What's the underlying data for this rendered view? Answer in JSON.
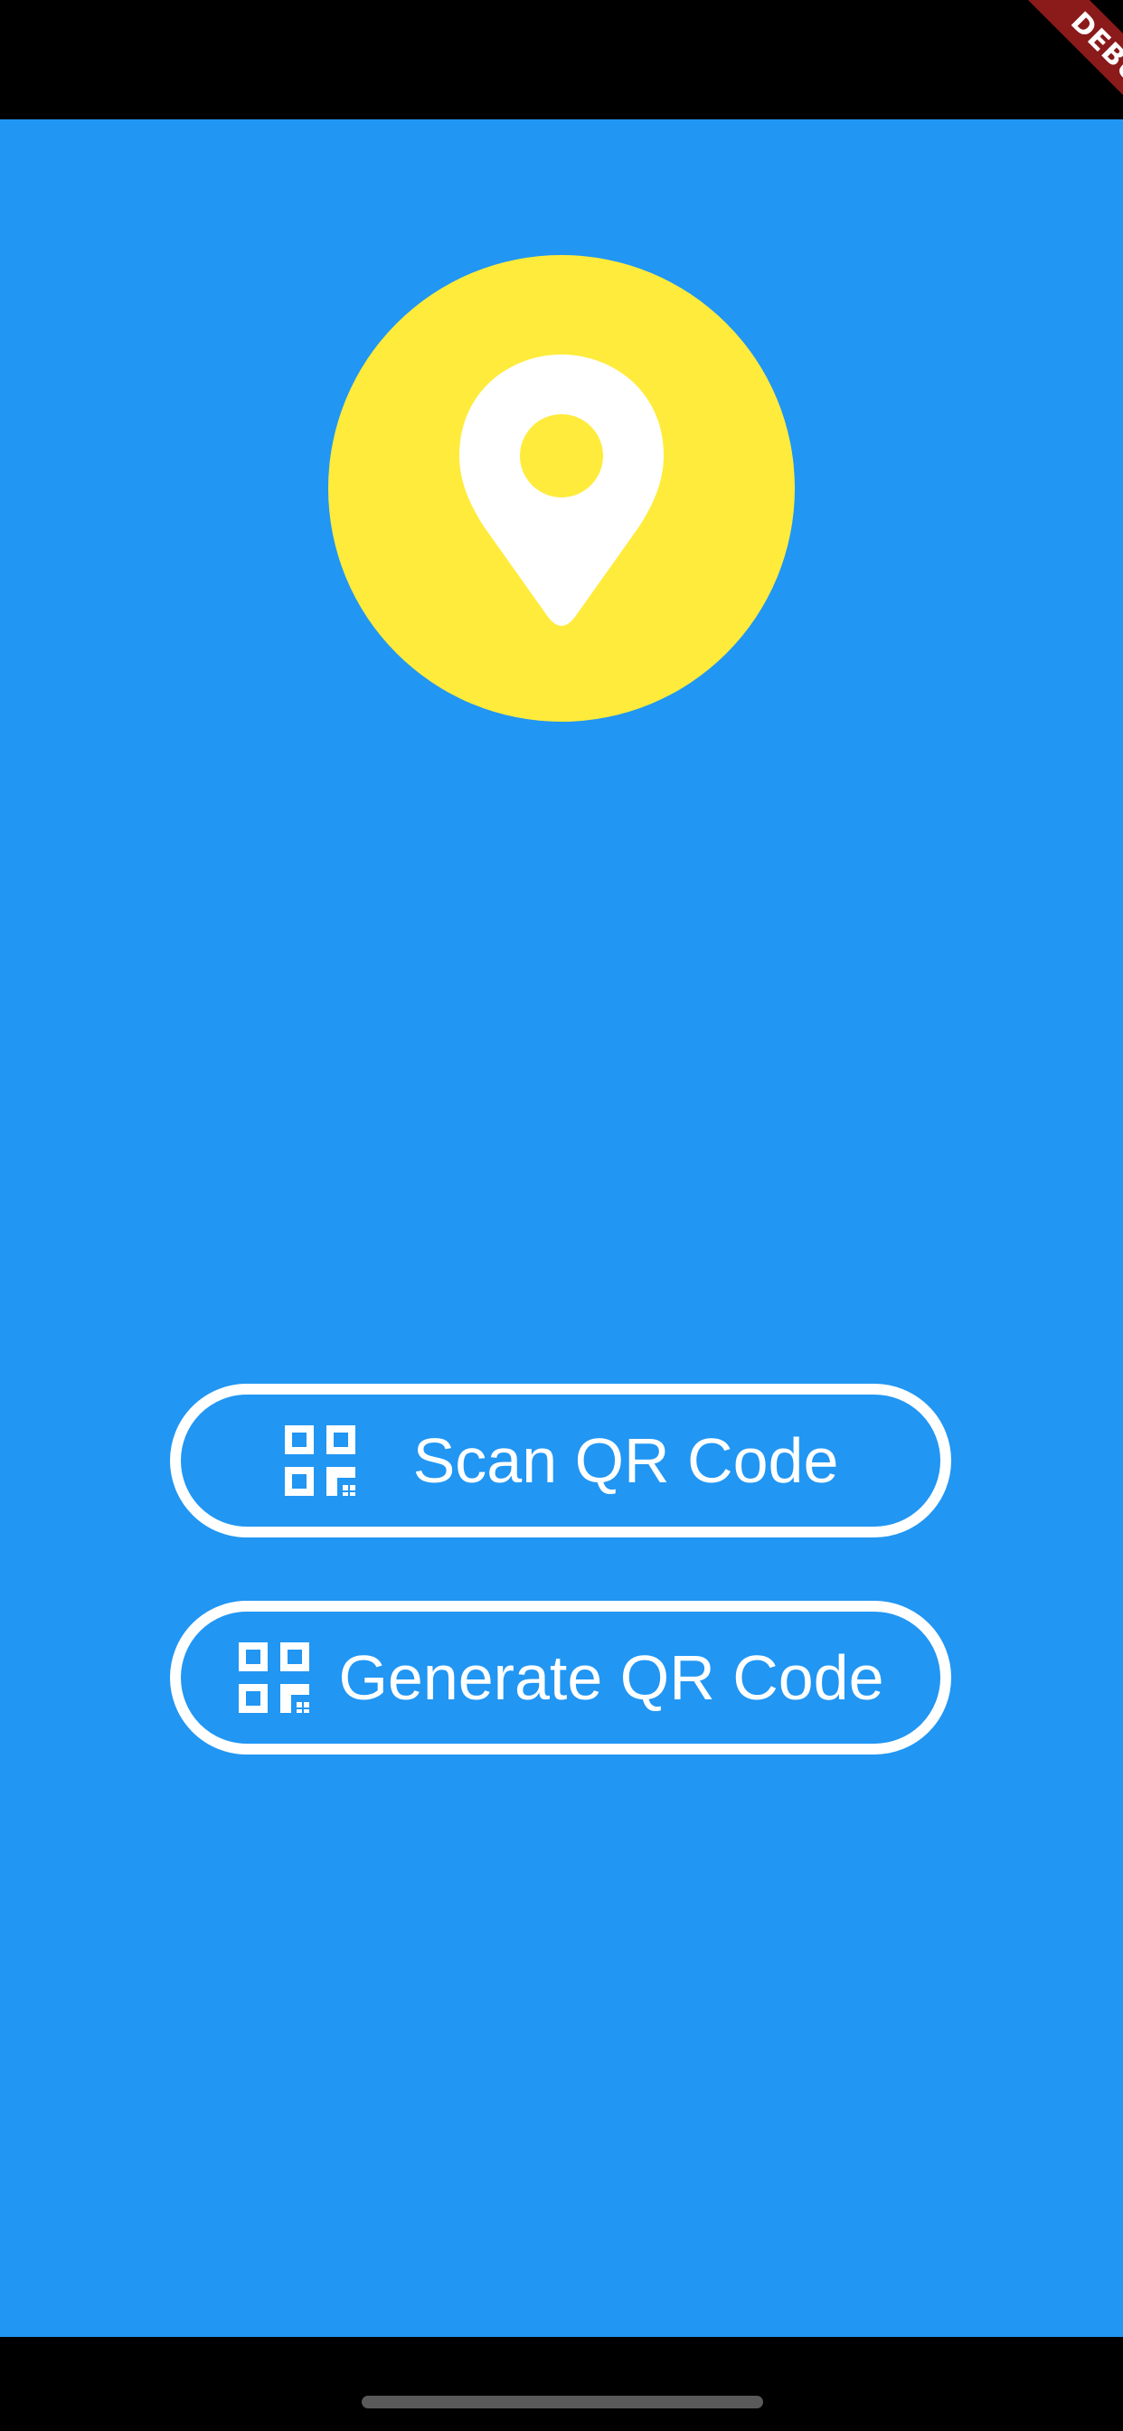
{
  "status_bar": {
    "debug_label": "DEBUG"
  },
  "logo": {
    "icon": "location-pin-icon",
    "circle_color": "#FFEB3B",
    "pin_color": "#FFFFFF"
  },
  "actions": {
    "scan": {
      "icon": "qr-code-icon",
      "label": "Scan QR Code"
    },
    "generate": {
      "icon": "qr-code-icon",
      "label": "Generate QR Code"
    }
  },
  "colors": {
    "background": "#2196F3",
    "system_bars": "#000000",
    "button_outline": "#FFFFFF",
    "debug_banner": "#8B1A1A"
  }
}
